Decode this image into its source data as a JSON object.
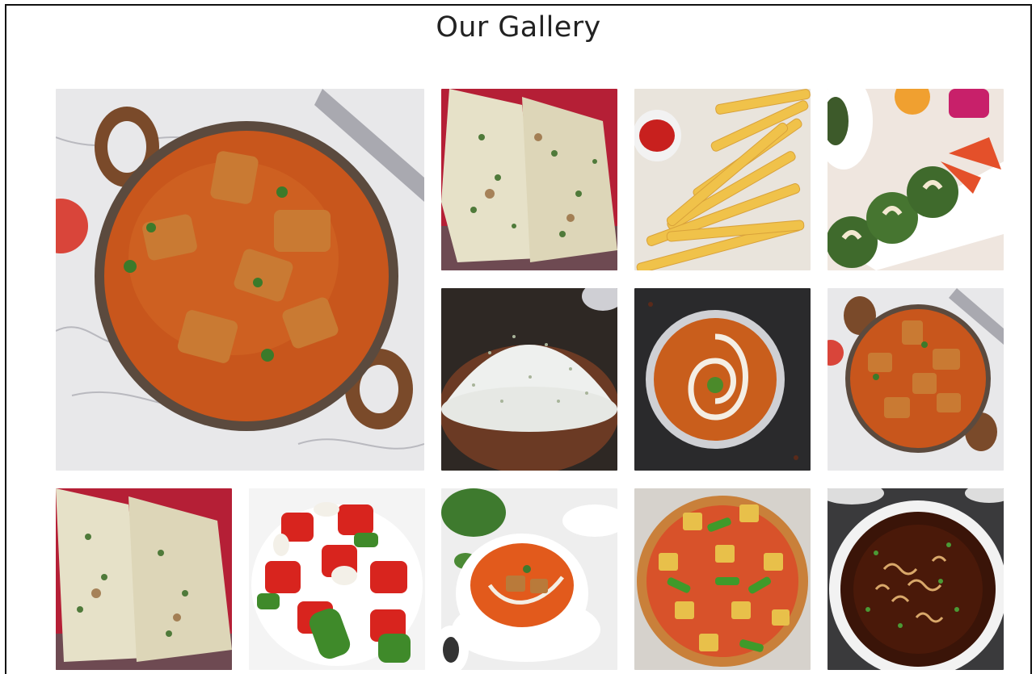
{
  "page": {
    "title": "Our Gallery"
  },
  "gallery": {
    "items": [
      {
        "dish": "paneer-curry-large",
        "icon": "paneer-curry"
      },
      {
        "dish": "garlic-naan",
        "icon": "naan"
      },
      {
        "dish": "french-fries",
        "icon": "fries"
      },
      {
        "dish": "hara-bhara-kabab",
        "icon": "kabab"
      },
      {
        "dish": "jeera-rice",
        "icon": "rice"
      },
      {
        "dish": "dal-makhani-bowl",
        "icon": "curry-bowl"
      },
      {
        "dish": "paneer-curry-small",
        "icon": "paneer-curry"
      },
      {
        "dish": "garlic-naan-2",
        "icon": "naan"
      },
      {
        "dish": "chilli-paneer",
        "icon": "chilli-paneer"
      },
      {
        "dish": "tomato-soup",
        "icon": "soup"
      },
      {
        "dish": "paneer-pizza",
        "icon": "pizza"
      },
      {
        "dish": "manchow-soup",
        "icon": "dark-soup"
      }
    ]
  },
  "colors": {
    "title_text": "#222222",
    "frame_border": "#111111",
    "background": "#ffffff"
  }
}
